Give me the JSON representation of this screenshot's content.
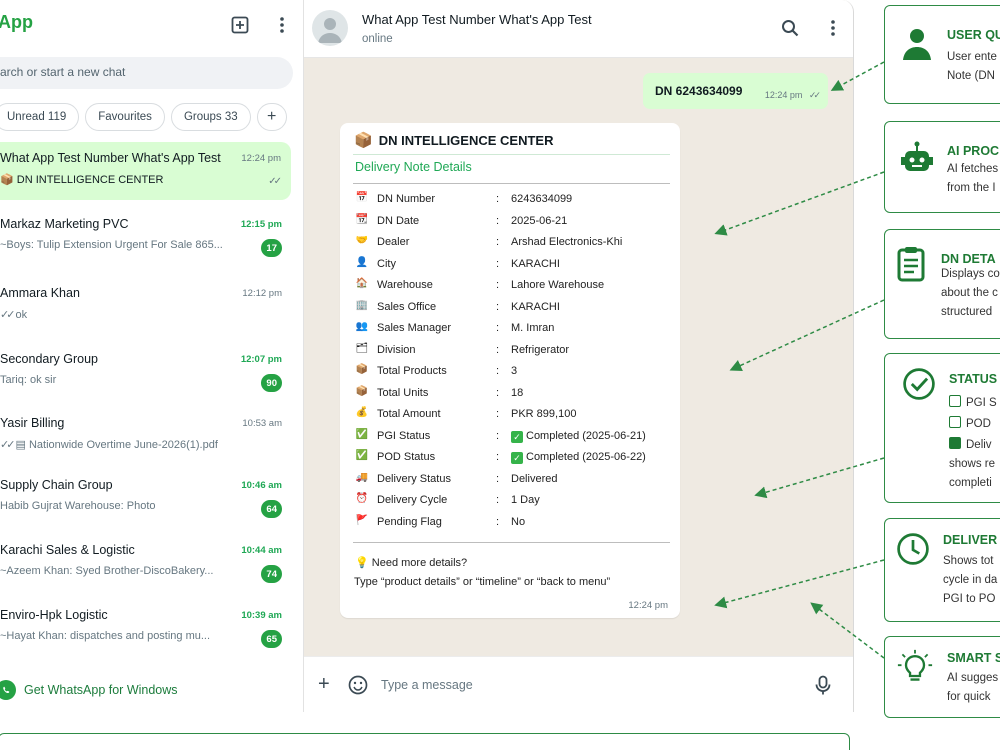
{
  "sidebar": {
    "app_title": "App",
    "search_placeholder": "arch or start a new chat",
    "chips": [
      "Unread 119",
      "Favourites",
      "Groups 33"
    ],
    "chats": [
      {
        "name": "What App Test Number What's App Test",
        "preview": "DN INTELLIGENCE CENTER",
        "time": "12:24 pm",
        "active": true,
        "ticks": "✓✓"
      },
      {
        "name": "Markaz Marketing PVC",
        "preview": "~Boys: Tulip Extension Urgent For Sale 865...",
        "time": "12:15 pm",
        "badge": "17",
        "unread": true
      },
      {
        "name": "Ammara Khan",
        "preview": "ok",
        "time": "12:12 pm",
        "preview_ticks": "✓✓"
      },
      {
        "name": "Secondary Group",
        "preview": "Tariq: ok sir",
        "time": "12:07 pm",
        "badge": "90",
        "unread": true
      },
      {
        "name": "Yasir Billing",
        "preview": "Nationwide Overtime June-2026(1).pdf",
        "time": "10:53 am",
        "preview_ticks": "✓✓"
      },
      {
        "name": "Supply Chain Group",
        "preview": "Habib Gujrat Warehouse:  Photo",
        "time": "10:46 am",
        "badge": "64",
        "unread": true
      },
      {
        "name": "Karachi Sales & Logistic",
        "preview": "~Azeem Khan: Syed Brother-DiscoBakery...",
        "time": "10:44 am",
        "badge": "74",
        "unread": true
      },
      {
        "name": "Enviro-Hpk Logistic",
        "preview": "~Hayat Khan: dispatches and posting mu...",
        "time": "10:39 am",
        "badge": "65",
        "unread": true
      }
    ],
    "get_whatsapp": "Get WhatsApp for Windows"
  },
  "conversation": {
    "contact_name": "What App Test Number What's App Test",
    "contact_status": "online",
    "outgoing": {
      "text": "DN 6243634099",
      "time": "12:24 pm",
      "ticks": "✓✓"
    },
    "card": {
      "title": "DN INTELLIGENCE CENTER",
      "subtitle": "Delivery Note Details",
      "rows": [
        {
          "icon": "📅",
          "label": "DN Number",
          "value": "6243634099"
        },
        {
          "icon": "📆",
          "label": "DN Date",
          "value": "2025-06-21"
        },
        {
          "icon": "🤝",
          "label": "Dealer",
          "value": "Arshad Electronics-Khi"
        },
        {
          "icon": "👤",
          "label": "City",
          "value": "KARACHI"
        },
        {
          "icon": "🏠",
          "label": "Warehouse",
          "value": "Lahore Warehouse"
        },
        {
          "icon": "🏢",
          "label": "Sales Office",
          "value": "KARACHI"
        },
        {
          "icon": "👥",
          "label": "Sales Manager",
          "value": "M. Imran"
        },
        {
          "icon": "🗂",
          "label": "Division",
          "value": "Refrigerator"
        },
        {
          "icon": "📦",
          "label": "Total Products",
          "value": "3"
        },
        {
          "icon": "📦",
          "label": "Total Units",
          "value": "18"
        },
        {
          "icon": "💰",
          "label": "Total Amount",
          "value": "PKR 899,100"
        },
        {
          "icon": "✅",
          "label": "PGI Status",
          "value": "Completed (2025-06-21)",
          "check": true
        },
        {
          "icon": "✅",
          "label": "POD Status",
          "value": "Completed (2025-06-22)",
          "check": true
        },
        {
          "icon": "🚚",
          "label": "Delivery Status",
          "value": "Delivered"
        },
        {
          "icon": "⏰",
          "label": "Delivery Cycle",
          "value": "1 Day"
        },
        {
          "icon": "🚩",
          "label": "Pending Flag",
          "value": "No"
        }
      ],
      "tip_line1": "Need more details?",
      "tip_line2": "Type “product details” or “timeline” or “back to menu”",
      "time": "12:24 pm"
    },
    "composer_placeholder": "Type a message"
  },
  "annotations": [
    {
      "title": "USER QU",
      "lines": [
        "User ente",
        "Note (DN"
      ],
      "icon": "user-icon"
    },
    {
      "title": "AI PROC",
      "lines": [
        "AI fetches",
        "from the I"
      ],
      "icon": "robot-icon"
    },
    {
      "title": "DN DETA",
      "lines": [
        "Displays co",
        "about the c",
        "structured"
      ],
      "icon": "clipboard-icon"
    },
    {
      "title": "STATUS",
      "lines": [
        "PGI S",
        "POD",
        "Deliv",
        "shows re",
        "completi"
      ],
      "icon": "check-circle-icon"
    },
    {
      "title": "DELIVER",
      "lines": [
        "Shows tot",
        "cycle in da",
        "PGI to PO"
      ],
      "icon": "clock-icon"
    },
    {
      "title": "SMART S",
      "lines": [
        "AI sugges",
        "for quick"
      ],
      "icon": "bulb-icon"
    }
  ],
  "colors": {
    "accent": "#25a244",
    "bubble_out": "#d9fdd3",
    "chat_bg": "#efeae2",
    "anno_border": "#2e8b45"
  }
}
